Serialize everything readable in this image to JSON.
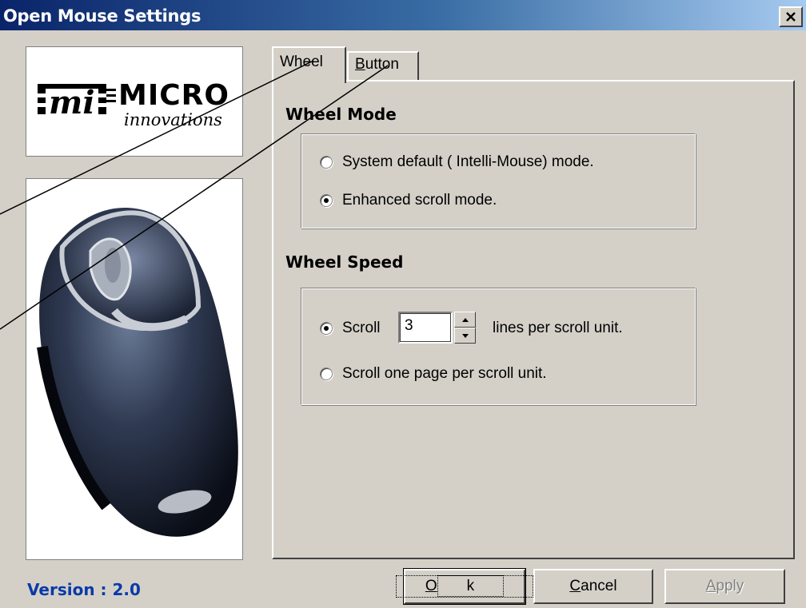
{
  "window": {
    "title": "Open Mouse Settings",
    "close_glyph": "✕"
  },
  "logo": {
    "mark": "mi",
    "brand": "MICRO",
    "tagline": "innovations"
  },
  "tabs": [
    {
      "label": "Wheel",
      "active": true
    },
    {
      "label": "Button",
      "accel": "B",
      "rest": "utton",
      "active": false
    }
  ],
  "wheel_mode": {
    "title": "Wheel Mode",
    "options": [
      {
        "label": "System default ( Intelli-Mouse) mode.",
        "checked": false
      },
      {
        "label": "Enhanced scroll mode.",
        "checked": true
      }
    ]
  },
  "wheel_speed": {
    "title": "Wheel Speed",
    "scroll_label": "Scroll",
    "scroll_value": "3",
    "lines_suffix": "lines per scroll unit.",
    "page_label": "Scroll one page per scroll unit.",
    "selected": "lines"
  },
  "buttons": {
    "ok": {
      "accel": "O",
      "rest": "k"
    },
    "cancel": {
      "accel": "C",
      "rest": "ancel"
    },
    "apply": {
      "accel": "A",
      "rest": "pply",
      "disabled": true
    }
  },
  "version": "Version : 2.0"
}
